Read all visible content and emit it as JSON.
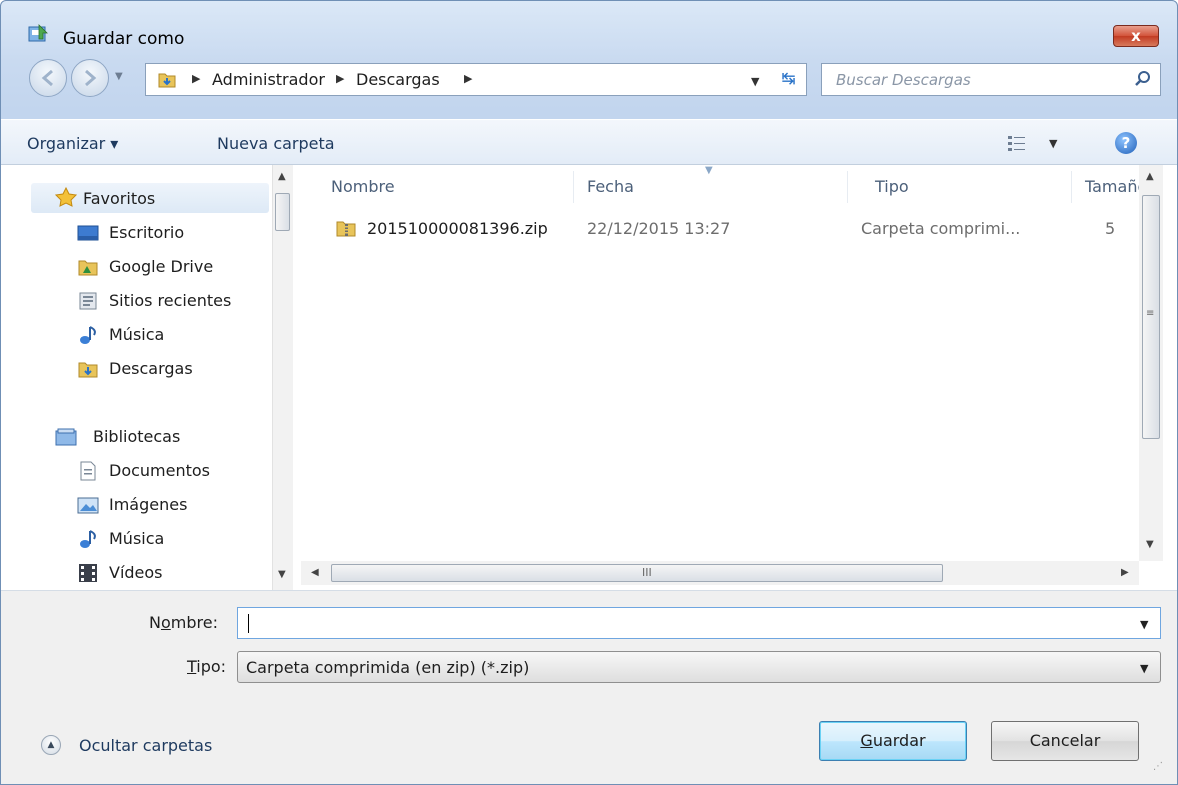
{
  "window": {
    "title": "Guardar como",
    "close_label": "x"
  },
  "address": {
    "crumbs": [
      "Administrador",
      "Descargas"
    ],
    "search_placeholder": "Buscar Descargas"
  },
  "toolbar": {
    "organize_label": "Organizar ▾",
    "new_folder_label": "Nueva carpeta"
  },
  "sidebar": {
    "favorites_header": "Favoritos",
    "favorites": [
      "Escritorio",
      "Google Drive",
      "Sitios recientes",
      "Música",
      "Descargas"
    ],
    "libraries_header": "Bibliotecas",
    "libraries": [
      "Documentos",
      "Imágenes",
      "Música",
      "Vídeos"
    ]
  },
  "filelist": {
    "columns": [
      "Nombre",
      "Fecha",
      "Tipo",
      "Tamañc"
    ],
    "rows": [
      {
        "name": "201510000081396.zip",
        "date": "22/12/2015 13:27",
        "type": "Carpeta comprimi...",
        "size": "5"
      }
    ],
    "hscroll_grip": "III"
  },
  "form": {
    "name_label_pre": "N",
    "name_label_ul": "o",
    "name_label_post": "mbre:",
    "name_value": "",
    "type_label_ul": "T",
    "type_label_post": "ipo:",
    "type_value": "Carpeta comprimida (en zip) (*.zip)"
  },
  "actions": {
    "hide_folders_label": "Ocultar carpetas",
    "save_ul": "G",
    "save_post": "uardar",
    "cancel_label": "Cancelar"
  },
  "colors": {
    "accent": "#3c7fb1",
    "chrome": "#c9daf0",
    "close": "#c23b22"
  }
}
